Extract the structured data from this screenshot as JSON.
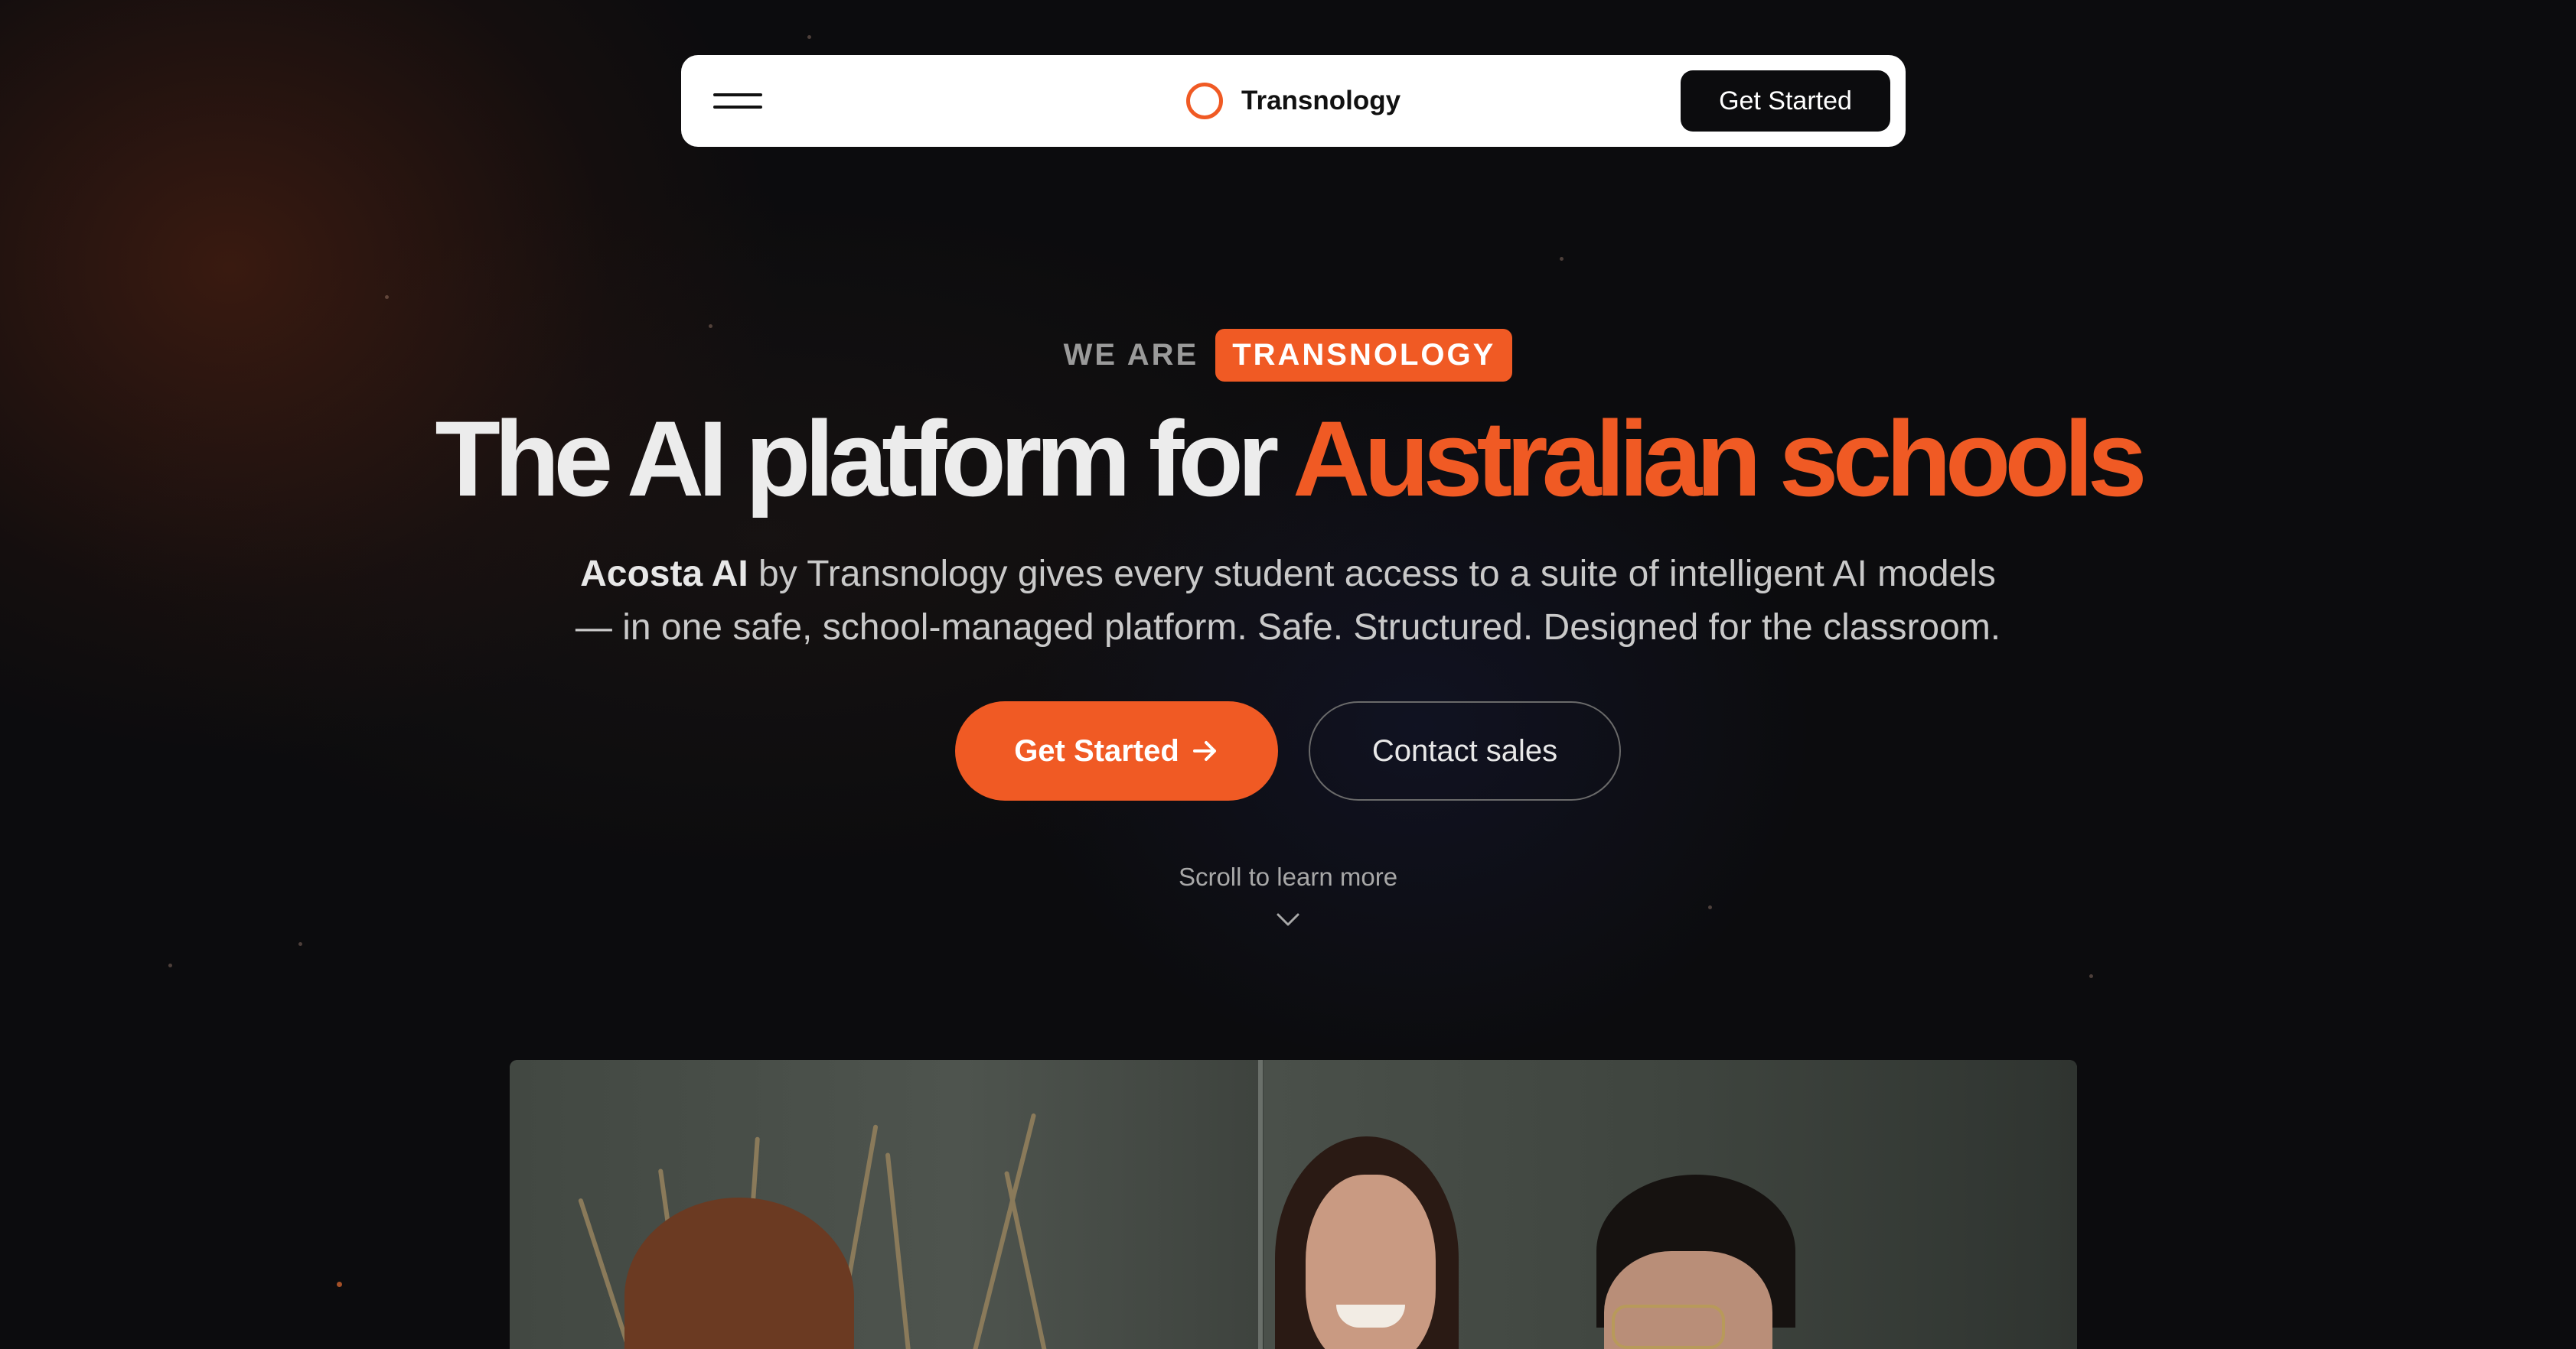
{
  "nav": {
    "brand_name": "Transnology",
    "cta_label": "Get Started"
  },
  "hero": {
    "eyebrow_lead": "WE ARE",
    "eyebrow_badge": "TRANSNOLOGY",
    "headline_main": "The AI platform for ",
    "headline_accent": "Australian schools",
    "subtext_strong": "Acosta AI",
    "subtext_line1": " by Transnology gives every student access to a suite of intelligent AI models",
    "subtext_line2": "— in one safe, school-managed platform. Safe. Structured. Designed for the classroom.",
    "primary_cta": "Get Started",
    "secondary_cta": "Contact sales",
    "scroll_hint": "Scroll to learn more"
  },
  "colors": {
    "accent": "#f05a24",
    "background": "#0c0c0e",
    "nav_bg": "#ffffff"
  },
  "icons": {
    "menu": "hamburger-icon",
    "logo": "ring-logo-icon",
    "cta_arrow": "arrow-right-icon",
    "scroll": "chevron-down-icon"
  }
}
